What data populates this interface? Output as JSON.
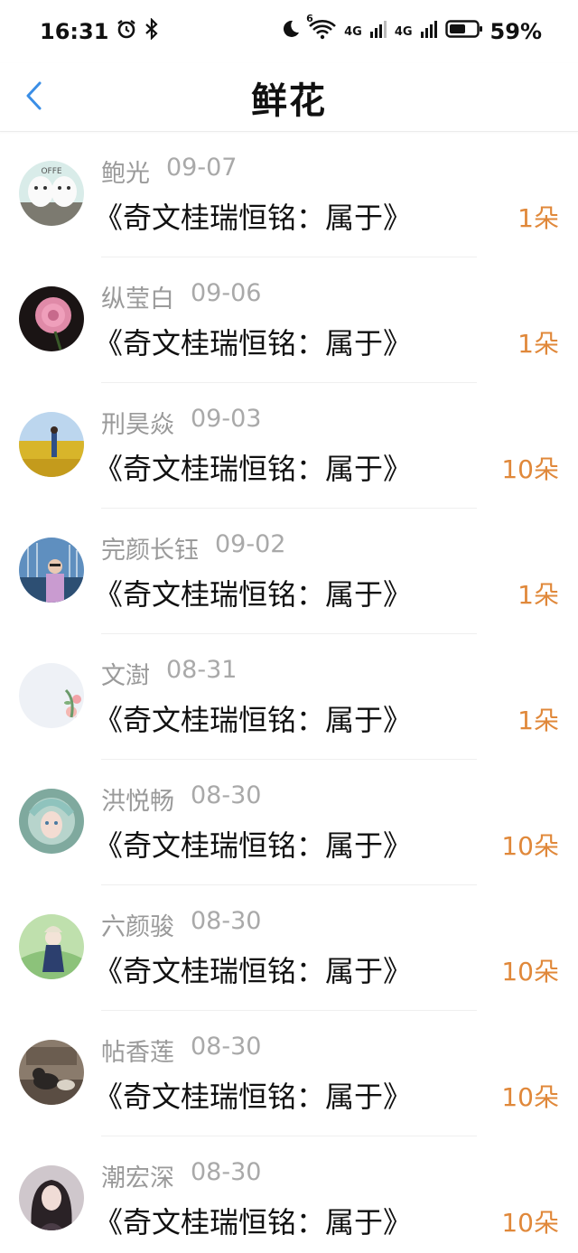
{
  "status_bar": {
    "time": "16:31",
    "battery": "59%",
    "net1": "4G",
    "net2": "4G",
    "wifi_badge": "6"
  },
  "header": {
    "title": "鲜花"
  },
  "colors": {
    "count": "#e0883a",
    "back": "#3a8ee6"
  },
  "items": [
    {
      "name": "鲍光",
      "date": "09-07",
      "gift": "《奇文桂瑞恒铭：属于》",
      "count": "1朵",
      "avatar": "cartoon-eggs-icon"
    },
    {
      "name": "纵莹白",
      "date": "09-06",
      "gift": "《奇文桂瑞恒铭：属于》",
      "count": "1朵",
      "avatar": "pink-rose-icon"
    },
    {
      "name": "刑昊焱",
      "date": "09-03",
      "gift": "《奇文桂瑞恒铭：属于》",
      "count": "10朵",
      "avatar": "flower-field-icon"
    },
    {
      "name": "完颜长钰",
      "date": "09-02",
      "gift": "《奇文桂瑞恒铭：属于》",
      "count": "1朵",
      "avatar": "harbor-selfie-icon"
    },
    {
      "name": "文澍",
      "date": "08-31",
      "gift": "《奇文桂瑞恒铭：属于》",
      "count": "1朵",
      "avatar": "floral-corner-icon"
    },
    {
      "name": "洪悦畅",
      "date": "08-30",
      "gift": "《奇文桂瑞恒铭：属于》",
      "count": "10朵",
      "avatar": "fantasy-girl-icon"
    },
    {
      "name": "六颜骏",
      "date": "08-30",
      "gift": "《奇文桂瑞恒铭：属于》",
      "count": "10朵",
      "avatar": "anime-character-icon"
    },
    {
      "name": "帖香莲",
      "date": "08-30",
      "gift": "《奇文桂瑞恒铭：属于》",
      "count": "10朵",
      "avatar": "cat-photo-icon"
    },
    {
      "name": "潮宏深",
      "date": "08-30",
      "gift": "《奇文桂瑞恒铭：属于》",
      "count": "10朵",
      "avatar": "portrait-photo-icon"
    }
  ]
}
